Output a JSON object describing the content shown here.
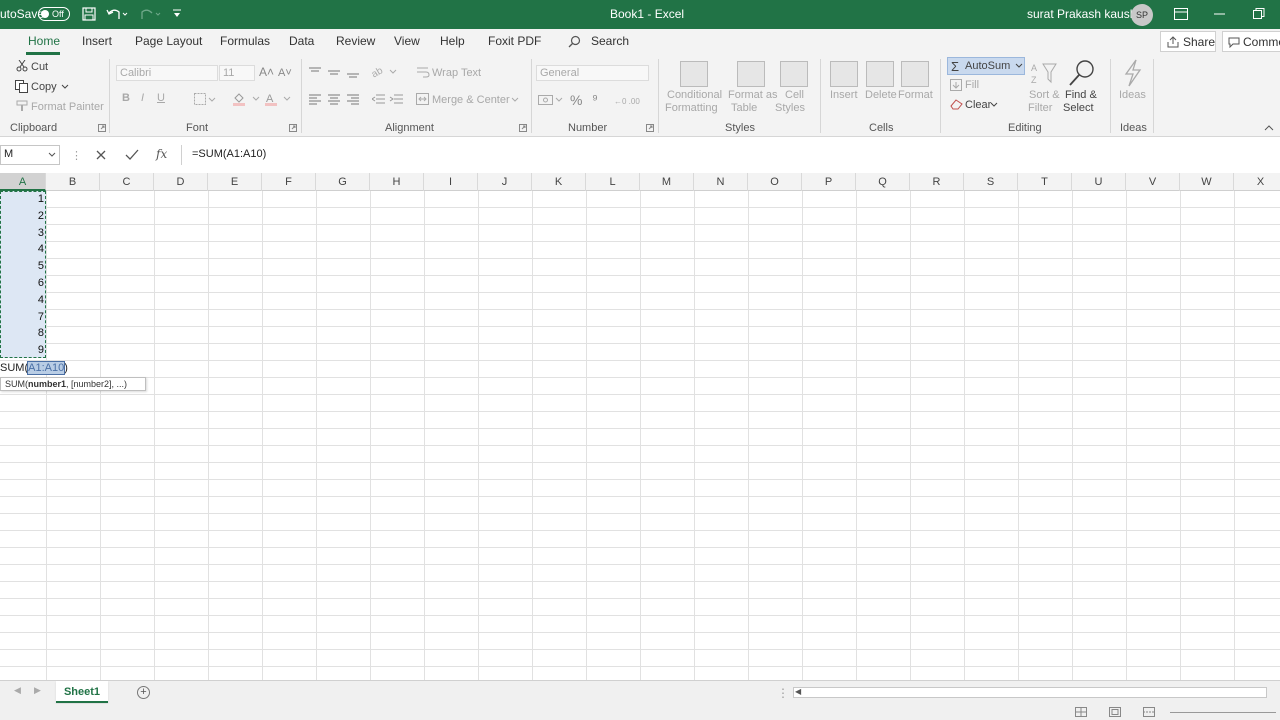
{
  "titlebar": {
    "autosave_label": "utoSave",
    "toggle_state": "Off",
    "title": "Book1  -  Excel",
    "user_name": "surat Prakash kaushik",
    "avatar_initials": "SP"
  },
  "tabs": [
    "Home",
    "Insert",
    "Page Layout",
    "Formulas",
    "Data",
    "Review",
    "View",
    "Help",
    "Foxit PDF"
  ],
  "tell_me": "Search",
  "share_label": "Share",
  "comments_label": "Comme",
  "ribbon": {
    "clipboard": {
      "cut": "Cut",
      "copy": "Copy",
      "format_painter": "Format Painter",
      "group": "Clipboard"
    },
    "font": {
      "name": "Calibri",
      "size": "11",
      "bold": "B",
      "italic": "I",
      "underline": "U",
      "group": "Font"
    },
    "alignment": {
      "wrap": "Wrap Text",
      "merge": "Merge & Center",
      "group": "Alignment"
    },
    "number": {
      "format": "General",
      "group": "Number"
    },
    "styles": {
      "conditional": "Conditional",
      "conditional2": "Formatting",
      "format_as": "Format as",
      "format_as2": "Table",
      "cell": "Cell",
      "cell2": "Styles",
      "group": "Styles"
    },
    "cells": {
      "insert": "Insert",
      "delete": "Delete",
      "format": "Format",
      "group": "Cells"
    },
    "editing": {
      "autosum": "AutoSum",
      "fill": "Fill",
      "clear": "Clear",
      "sort": "Sort &",
      "sort2": "Filter",
      "find": "Find &",
      "find2": "Select",
      "group": "Editing"
    },
    "ideas": {
      "label": "Ideas",
      "group": "Ideas"
    }
  },
  "formula_bar": {
    "name_box": "M",
    "formula": "=SUM(A1:A10)"
  },
  "columns": [
    "A",
    "B",
    "C",
    "D",
    "E",
    "F",
    "G",
    "H",
    "I",
    "J",
    "K",
    "L",
    "M",
    "N",
    "O",
    "P",
    "Q",
    "R",
    "S",
    "T",
    "U",
    "V",
    "W",
    "X"
  ],
  "cell_values": [
    "1",
    "2",
    "3",
    "4",
    "5",
    "6",
    "4",
    "7",
    "8",
    "9"
  ],
  "edit_cell": {
    "prefix": "SUM(",
    "range": "A1:A10",
    "suffix": ")"
  },
  "tooltip": {
    "fn": "SUM(",
    "arg1": "number1",
    "rest": ", [number2], ...)"
  },
  "sheet_tab": "Sheet1",
  "colors": {
    "excel_green": "#217346",
    "selection": "#dde7f4"
  }
}
